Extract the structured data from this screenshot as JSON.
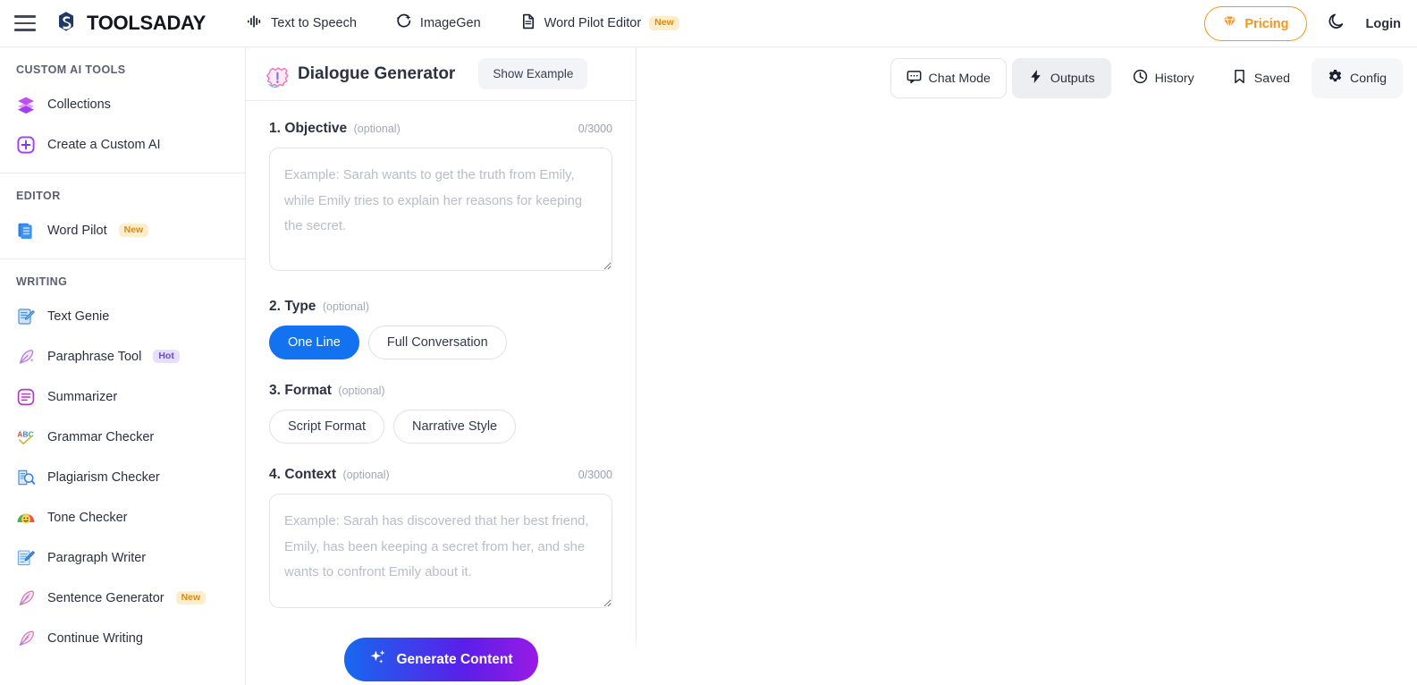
{
  "topbar": {
    "menu_icon": "hamburger-icon",
    "logo_text": "TOOLSADAY",
    "nav": [
      {
        "label": "Text to Speech",
        "icon": "waveform-icon",
        "badge": ""
      },
      {
        "label": "ImageGen",
        "icon": "sparkle-image-icon",
        "badge": ""
      },
      {
        "label": "Word Pilot Editor",
        "icon": "document-icon",
        "badge": "New"
      }
    ],
    "pricing_label": "Pricing",
    "pricing_icon": "gem-icon",
    "pricing_color": "#f7941d",
    "theme_icon": "moon-icon",
    "login_label": "Login"
  },
  "sidebar": {
    "sections": [
      {
        "title": "CUSTOM AI TOOLS",
        "items": [
          {
            "label": "Collections",
            "icon": "layers-icon",
            "badge": ""
          },
          {
            "label": "Create a Custom AI",
            "icon": "plus-square-icon",
            "badge": ""
          }
        ]
      },
      {
        "title": "EDITOR",
        "items": [
          {
            "label": "Word Pilot",
            "icon": "document-blue-icon",
            "badge": "New"
          }
        ]
      },
      {
        "title": "WRITING",
        "items": [
          {
            "label": "Text Genie",
            "icon": "document-pen-icon",
            "badge": ""
          },
          {
            "label": "Paraphrase Tool",
            "icon": "quill-sparkle-icon",
            "badge": "Hot"
          },
          {
            "label": "Summarizer",
            "icon": "summarize-icon",
            "badge": ""
          },
          {
            "label": "Grammar Checker",
            "icon": "abc-check-icon",
            "badge": ""
          },
          {
            "label": "Plagiarism Checker",
            "icon": "book-magnifier-icon",
            "badge": ""
          },
          {
            "label": "Tone Checker",
            "icon": "gauge-face-icon",
            "badge": ""
          },
          {
            "label": "Paragraph Writer",
            "icon": "page-pencil-icon",
            "badge": ""
          },
          {
            "label": "Sentence Generator",
            "icon": "feather-icon",
            "badge": "New"
          },
          {
            "label": "Continue Writing",
            "icon": "feather-icon",
            "badge": ""
          }
        ]
      }
    ]
  },
  "form": {
    "title": "Dialogue Generator",
    "title_icon": "dialogue-bubble-icon",
    "show_example_label": "Show Example",
    "fields": [
      {
        "number": "1.",
        "label": "Objective",
        "optional": "(optional)",
        "counter": "0/3000",
        "placeholder": "Example: Sarah wants to get the truth from Emily, while Emily tries to explain her reasons for keeping the secret.",
        "value": ""
      },
      {
        "number": "2.",
        "label": "Type",
        "optional": "(optional)",
        "options": [
          "One Line",
          "Full Conversation"
        ],
        "selected": "One Line"
      },
      {
        "number": "3.",
        "label": "Format",
        "optional": "(optional)",
        "options": [
          "Script Format",
          "Narrative Style"
        ],
        "selected": ""
      },
      {
        "number": "4.",
        "label": "Context",
        "optional": "(optional)",
        "counter": "0/3000",
        "placeholder": "Example: Sarah has discovered that her best friend, Emily, has been keeping a secret from her, and she wants to confront Emily about it.",
        "value": ""
      }
    ],
    "generate_label": "Generate Content",
    "generate_icon": "sparkles-icon",
    "accent_blue": "#1272f0"
  },
  "output": {
    "toolbar": [
      {
        "label": "Chat Mode",
        "icon": "chat-bubble-icon",
        "style": "outlined"
      },
      {
        "label": "Outputs",
        "icon": "lightning-icon",
        "style": "filled"
      },
      {
        "label": "History",
        "icon": "clock-icon",
        "style": "plain"
      },
      {
        "label": "Saved",
        "icon": "bookmark-icon",
        "style": "plain"
      },
      {
        "label": "Config",
        "icon": "gear-icon",
        "style": "subtle"
      }
    ],
    "body_text": ""
  }
}
